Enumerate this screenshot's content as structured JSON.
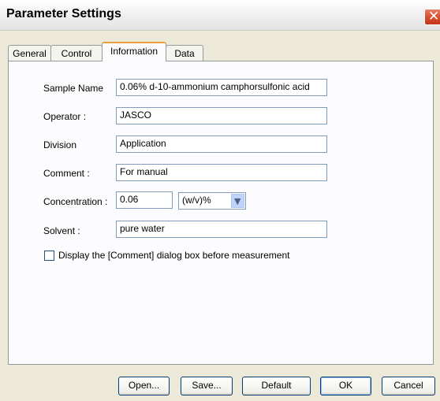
{
  "window": {
    "title": "Parameter Settings",
    "close_glyph": "✕"
  },
  "tabs": [
    {
      "label": "General"
    },
    {
      "label": "Control"
    },
    {
      "label": "Information",
      "active": true
    },
    {
      "label": "Data"
    }
  ],
  "form": {
    "sample_name": {
      "label": "Sample Name",
      "value": "0.06% d-10-ammonium camphorsulfonic acid"
    },
    "operator": {
      "label": "Operator :",
      "value": "JASCO"
    },
    "division": {
      "label": "Division",
      "value": "Application"
    },
    "comment": {
      "label": "Comment :",
      "value": "For manual"
    },
    "concentration": {
      "label": "Concentration :",
      "value": "0.06",
      "unit": "(w/v)%"
    },
    "solvent": {
      "label": "Solvent :",
      "value": "pure water"
    },
    "display_comment_checkbox": {
      "label": "Display the [Comment] dialog box before measurement",
      "checked": false
    }
  },
  "buttons": {
    "open": "Open...",
    "save": "Save...",
    "default": "Default",
    "ok": "OK",
    "cancel": "Cancel"
  },
  "icons": {
    "close": "close-icon",
    "dropdown": "chevron-down-icon"
  },
  "colors": {
    "dialog_bg": "#ece9d8",
    "close_button": "#d6502f",
    "active_tab_accent": "#e6a33b",
    "field_border": "#7f9db9"
  }
}
